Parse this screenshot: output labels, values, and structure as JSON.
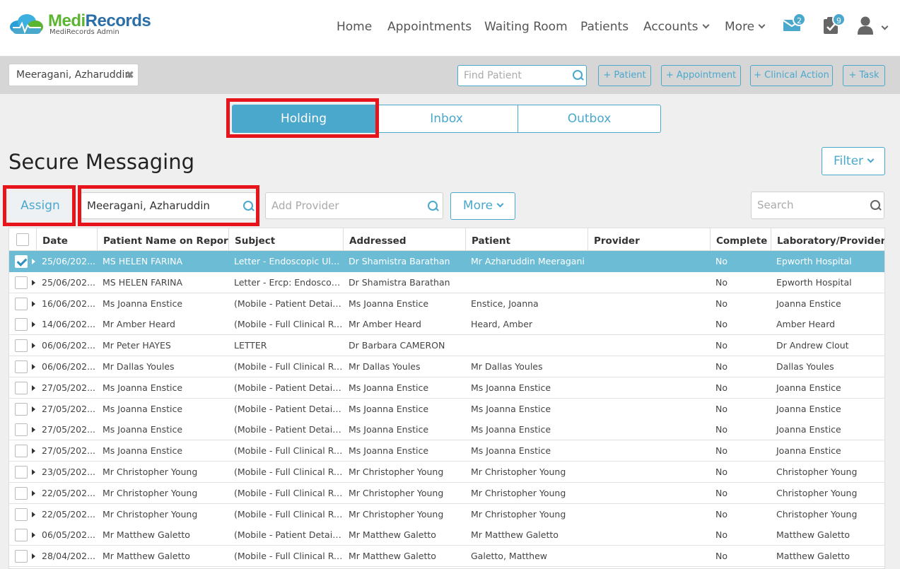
{
  "header": {
    "brand_medi": "Medi",
    "brand_records": "Records",
    "brand_sub": "MediRecords Admin",
    "nav": [
      {
        "label": "Home",
        "dropdown": false
      },
      {
        "label": "Appointments",
        "dropdown": false
      },
      {
        "label": "Waiting Room",
        "dropdown": false
      },
      {
        "label": "Patients",
        "dropdown": false
      },
      {
        "label": "Accounts",
        "dropdown": true
      },
      {
        "label": "More",
        "dropdown": true
      }
    ],
    "messages_badge": "2",
    "tasks_badge": "9"
  },
  "patient_bar": {
    "current_patient": "Meeragani, Azharuddin",
    "find_placeholder": "Find Patient",
    "buttons": [
      "+ Patient",
      "+ Appointment",
      "+ Clinical Action",
      "+ Task"
    ]
  },
  "tabs": [
    "Holding",
    "Inbox",
    "Outbox"
  ],
  "page_title": "Secure Messaging",
  "filter_label": "Filter",
  "toolbar": {
    "assign_label": "Assign",
    "patient_value": "Meeragani, Azharuddin",
    "provider_placeholder": "Add Provider",
    "more_label": "More",
    "search_placeholder": "Search"
  },
  "table": {
    "columns": [
      "Date",
      "Patient Name on Report",
      "Subject",
      "Addressed",
      "Patient",
      "Provider",
      "Complete",
      "Laboratory/Provider"
    ],
    "rows": [
      {
        "date": "25/06/202...",
        "name": "MS HELEN FARINA",
        "subject": "Letter - Endoscopic Ultra...",
        "addressed": "Dr Shamistra Barathan",
        "patient": "Mr Azharuddin Meeragani",
        "provider": "",
        "complete": "No",
        "lab": "Epworth Hospital",
        "selected": true
      },
      {
        "date": "25/06/202...",
        "name": "MS HELEN FARINA",
        "subject": "Letter - Ercp: Endoscopy...",
        "addressed": "Dr Shamistra Barathan",
        "patient": "",
        "provider": "",
        "complete": "No",
        "lab": "Epworth Hospital",
        "selected": false
      },
      {
        "date": "16/06/202...",
        "name": "Ms Joanna Enstice",
        "subject": "(Mobile - Patient Details)...",
        "addressed": "Ms Joanna Enstice",
        "patient": "Enstice, Joanna",
        "provider": "",
        "complete": "No",
        "lab": "Joanna Enstice",
        "selected": false
      },
      {
        "date": "14/06/202...",
        "name": "Mr Amber Heard",
        "subject": "(Mobile - Full Clinical Rec...",
        "addressed": "Mr Amber Heard",
        "patient": "Heard, Amber",
        "provider": "",
        "complete": "No",
        "lab": "Amber Heard",
        "selected": false
      },
      {
        "date": "06/06/202...",
        "name": "Mr Peter HAYES",
        "subject": "LETTER",
        "addressed": "Dr Barbara CAMERON",
        "patient": "",
        "provider": "",
        "complete": "No",
        "lab": "Dr Andrew Clout",
        "selected": false
      },
      {
        "date": "06/06/202...",
        "name": "Mr Dallas Youles",
        "subject": "(Mobile - Full Clinical Rec...",
        "addressed": "Mr Dallas Youles",
        "patient": "Mr Dallas Youles",
        "provider": "",
        "complete": "No",
        "lab": "Dallas Youles",
        "selected": false
      },
      {
        "date": "27/05/202...",
        "name": "Ms Joanna Enstice",
        "subject": "(Mobile - Patient Details)...",
        "addressed": "Ms Joanna Enstice",
        "patient": "Ms Joanna Enstice",
        "provider": "",
        "complete": "No",
        "lab": "Joanna Enstice",
        "selected": false
      },
      {
        "date": "27/05/202...",
        "name": "Ms Joanna Enstice",
        "subject": "(Mobile - Patient Details)...",
        "addressed": "Ms Joanna Enstice",
        "patient": "Ms Joanna Enstice",
        "provider": "",
        "complete": "No",
        "lab": "Joanna Enstice",
        "selected": false
      },
      {
        "date": "27/05/202...",
        "name": "Ms Joanna Enstice",
        "subject": "(Mobile - Patient Details)...",
        "addressed": "Ms Joanna Enstice",
        "patient": "Ms Joanna Enstice",
        "provider": "",
        "complete": "No",
        "lab": "Joanna Enstice",
        "selected": false
      },
      {
        "date": "27/05/202...",
        "name": "Ms Joanna Enstice",
        "subject": "(Mobile - Full Clinical Rec...",
        "addressed": "Ms Joanna Enstice",
        "patient": "Ms Joanna Enstice",
        "provider": "",
        "complete": "No",
        "lab": "Joanna Enstice",
        "selected": false
      },
      {
        "date": "23/05/202...",
        "name": "Mr Christopher Young",
        "subject": "(Mobile - Full Clinical Rec...",
        "addressed": "Mr Christopher Young",
        "patient": "Mr Christopher Young",
        "provider": "",
        "complete": "No",
        "lab": "Christopher Young",
        "selected": false
      },
      {
        "date": "22/05/202...",
        "name": "Mr Christopher Young",
        "subject": "(Mobile - Full Clinical Rec...",
        "addressed": "Mr Christopher Young",
        "patient": "Mr Christopher Young",
        "provider": "",
        "complete": "No",
        "lab": "Christopher Young",
        "selected": false
      },
      {
        "date": "22/05/202...",
        "name": "Mr Christopher Young",
        "subject": "(Mobile - Full Clinical Rec...",
        "addressed": "Mr Christopher Young",
        "patient": "Mr Christopher Young",
        "provider": "",
        "complete": "No",
        "lab": "Christopher Young",
        "selected": false
      },
      {
        "date": "06/05/202...",
        "name": "Mr Matthew Galetto",
        "subject": "(Mobile - Patient Details)...",
        "addressed": "Mr Matthew Galetto",
        "patient": "Mr Matthew Galetto",
        "provider": "",
        "complete": "No",
        "lab": "Matthew Galetto",
        "selected": false
      },
      {
        "date": "28/04/202...",
        "name": "Mr Matthew Galetto",
        "subject": "(Mobile - Full Clinical Rec...",
        "addressed": "Mr Matthew Galetto",
        "patient": "Galetto, Matthew",
        "provider": "",
        "complete": "No",
        "lab": "Matthew Galetto",
        "selected": false
      }
    ]
  },
  "colors": {
    "accent": "#4aa8cc",
    "selected_row": "#6cbcd6",
    "highlight": "#e8141b",
    "brand_green": "#5cb531",
    "brand_blue": "#2b6fa6"
  },
  "icons": {
    "messages": "envelope-icon",
    "tasks": "clipboard-check-icon",
    "user": "user-icon",
    "search": "search-icon"
  }
}
